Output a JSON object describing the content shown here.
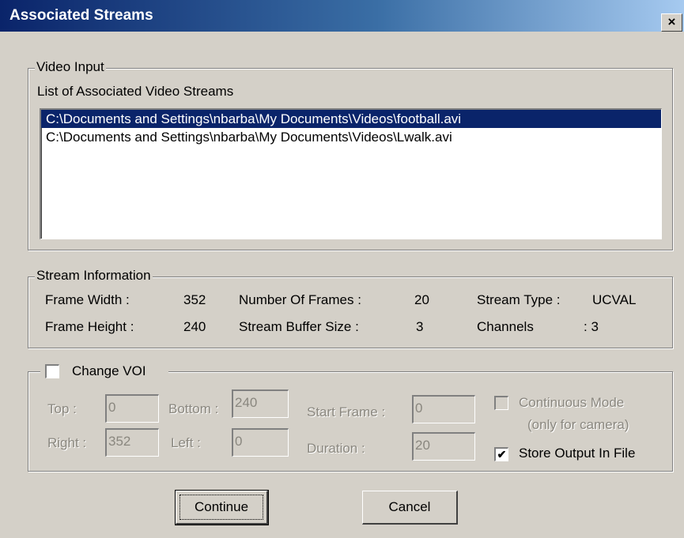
{
  "window": {
    "title": "Associated Streams",
    "close_glyph": "×"
  },
  "video_input": {
    "legend": "Video Input",
    "list_label": "List of Associated Video Streams",
    "streams": [
      "C:\\Documents and Settings\\nbarba\\My Documents\\Videos\\football.avi",
      "C:\\Documents and Settings\\nbarba\\My Documents\\Videos\\Lwalk.avi"
    ],
    "selected_index": 0
  },
  "stream_info": {
    "legend": "Stream Information",
    "frame_width_label": "Frame Width  :",
    "frame_width": "352",
    "frame_height_label": "Frame Height  :",
    "frame_height": "240",
    "num_frames_label": "Number Of Frames  :",
    "num_frames": "20",
    "buffer_size_label": "Stream Buffer Size  :",
    "buffer_size": "3",
    "stream_type_label": "Stream Type :",
    "stream_type": "UCVAL",
    "channels_label": "Channels",
    "channels": ": 3"
  },
  "voi": {
    "change_label": "Change VOI",
    "change_checked": false,
    "top_label": "Top   :",
    "top": "0",
    "bottom_label": "Bottom :",
    "bottom": "240",
    "right_label": "Right :",
    "right": "352",
    "left_label": "Left     :",
    "left": "0",
    "start_frame_label": "Start Frame :",
    "start_frame": "0",
    "duration_label": "Duration :",
    "duration": "20",
    "continuous_label": "Continuous Mode",
    "continuous_sub": "(only for camera)",
    "continuous_checked": false,
    "store_label": "Store Output In File",
    "store_checked": true
  },
  "buttons": {
    "continue": "Continue",
    "cancel": "Cancel"
  },
  "colors": {
    "title_start": "#0a246a",
    "title_end": "#a6caf0",
    "face": "#d4d0c8",
    "selection": "#0a246a"
  }
}
